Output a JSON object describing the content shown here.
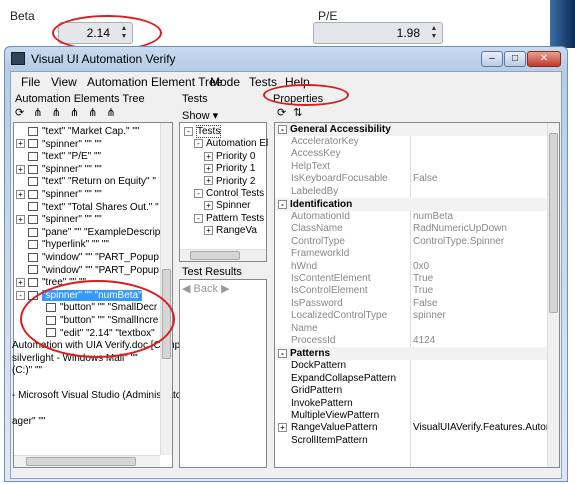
{
  "top": {
    "beta_label": "Beta",
    "beta_value": "2.14",
    "pe_label": "P/E",
    "pe_value": "1.98"
  },
  "window": {
    "title": "Visual UI Automation Verify",
    "minimize": "–",
    "maximize": "□",
    "close": "✕"
  },
  "menu": [
    "File",
    "View",
    "Automation Element Tree",
    "Mode",
    "Tests",
    "Help"
  ],
  "left_panel": {
    "title": "Automation Elements Tree",
    "rows": [
      {
        "pm": "",
        "text": "\"text\" \"Market Cap.\" \"\"",
        "sel": false
      },
      {
        "pm": "+",
        "text": "\"spinner\" \"\" \"\"",
        "sel": false
      },
      {
        "pm": "",
        "text": "\"text\" \"P/E\" \"\"",
        "sel": false
      },
      {
        "pm": "+",
        "text": "\"spinner\" \"\" \"\"",
        "sel": false
      },
      {
        "pm": "",
        "text": "\"text\" \"Return on Equity\" \"",
        "sel": false
      },
      {
        "pm": "+",
        "text": "\"spinner\" \"\" \"\"",
        "sel": false
      },
      {
        "pm": "",
        "text": "\"text\" \"Total Shares Out.\" \"",
        "sel": false
      },
      {
        "pm": "+",
        "text": "\"spinner\" \"\" \"\"",
        "sel": false
      },
      {
        "pm": "",
        "text": "\"pane\" \"\" \"ExampleDescrip",
        "sel": false
      },
      {
        "pm": "",
        "text": "\"hyperlink\" \"\" \"\"",
        "sel": false
      },
      {
        "pm": "",
        "text": "\"window\" \"\" \"PART_Popup",
        "sel": false
      },
      {
        "pm": "",
        "text": "\"window\" \"\" \"PART_Popup",
        "sel": false
      },
      {
        "pm": "+",
        "text": "\"tree\" \"\" \"\"",
        "sel": false
      },
      {
        "pm": "-",
        "text": "\"spinner\" \"\" \"numBeta\"",
        "sel": true
      },
      {
        "pm": "",
        "text": "\"button\" \"\" \"SmallDecr",
        "sel": false
      },
      {
        "pm": "",
        "text": "\"button\" \"\" \"SmallIncre",
        "sel": false
      },
      {
        "pm": "",
        "text": "\"edit\" \"2.14\" \"textbox\"",
        "sel": false
      }
    ],
    "lower_lines": [
      "Automation with UIA Verify.doc [Comp",
      "silverlight - Windows Mail\" \"\"",
      "(C:)\" \"\"",
      "",
      "- Microsoft Visual Studio (Administrato",
      "",
      "ager\" \"\""
    ]
  },
  "tests_panel": {
    "title": "Tests",
    "show_label": "Show",
    "tree": [
      {
        "indent": 0,
        "pm": "-",
        "text": "Tests"
      },
      {
        "indent": 1,
        "pm": "-",
        "text": "Automation El"
      },
      {
        "indent": 2,
        "pm": "+",
        "text": "Priority 0"
      },
      {
        "indent": 2,
        "pm": "+",
        "text": "Priority 1"
      },
      {
        "indent": 2,
        "pm": "+",
        "text": "Priority 2"
      },
      {
        "indent": 1,
        "pm": "-",
        "text": "Control Tests"
      },
      {
        "indent": 2,
        "pm": "+",
        "text": "Spinner"
      },
      {
        "indent": 1,
        "pm": "-",
        "text": "Pattern Tests"
      },
      {
        "indent": 2,
        "pm": "+",
        "text": "RangeVa"
      }
    ],
    "results_title": "Test Results",
    "back_label": "Back"
  },
  "properties_panel": {
    "title": "Properties",
    "rows": [
      {
        "type": "cat",
        "sign": "-",
        "name": "General Accessibility"
      },
      {
        "type": "prop",
        "name": "AcceleratorKey",
        "value": "",
        "dark": false
      },
      {
        "type": "prop",
        "name": "AccessKey",
        "value": "",
        "dark": false
      },
      {
        "type": "prop",
        "name": "HelpText",
        "value": "",
        "dark": false
      },
      {
        "type": "prop",
        "name": "IsKeyboardFocusable",
        "value": "False",
        "dark": false
      },
      {
        "type": "prop",
        "name": "LabeledBy",
        "value": "",
        "dark": false
      },
      {
        "type": "cat",
        "sign": "-",
        "name": "Identification"
      },
      {
        "type": "prop",
        "name": "AutomationId",
        "value": "numBeta",
        "dark": false
      },
      {
        "type": "prop",
        "name": "ClassName",
        "value": "RadNumericUpDown",
        "dark": false
      },
      {
        "type": "prop",
        "name": "ControlType",
        "value": "ControlType.Spinner",
        "dark": false
      },
      {
        "type": "prop",
        "name": "FrameworkId",
        "value": "",
        "dark": false
      },
      {
        "type": "prop",
        "name": "hWnd",
        "value": "0x0",
        "dark": false
      },
      {
        "type": "prop",
        "name": "IsContentElement",
        "value": "True",
        "dark": false
      },
      {
        "type": "prop",
        "name": "IsControlElement",
        "value": "True",
        "dark": false
      },
      {
        "type": "prop",
        "name": "IsPassword",
        "value": "False",
        "dark": false
      },
      {
        "type": "prop",
        "name": "LocalizedControlType",
        "value": "spinner",
        "dark": false
      },
      {
        "type": "prop",
        "name": "Name",
        "value": "",
        "dark": false
      },
      {
        "type": "prop",
        "name": "ProcessId",
        "value": "4124",
        "dark": false
      },
      {
        "type": "cat",
        "sign": "-",
        "name": "Patterns"
      },
      {
        "type": "prop",
        "name": "DockPattern",
        "value": "",
        "dark": true
      },
      {
        "type": "prop",
        "name": "ExpandCollapsePattern",
        "value": "",
        "dark": true
      },
      {
        "type": "prop",
        "name": "GridPattern",
        "value": "",
        "dark": true
      },
      {
        "type": "prop",
        "name": "InvokePattern",
        "value": "",
        "dark": true
      },
      {
        "type": "prop",
        "name": "MultipleViewPattern",
        "value": "",
        "dark": true
      },
      {
        "type": "prop",
        "name": "RangeValuePattern",
        "value": "VisualUIAVerify.Features.Automation",
        "dark": true,
        "sign": "+"
      },
      {
        "type": "prop",
        "name": "ScrollItemPattern",
        "value": "",
        "dark": true
      }
    ]
  }
}
